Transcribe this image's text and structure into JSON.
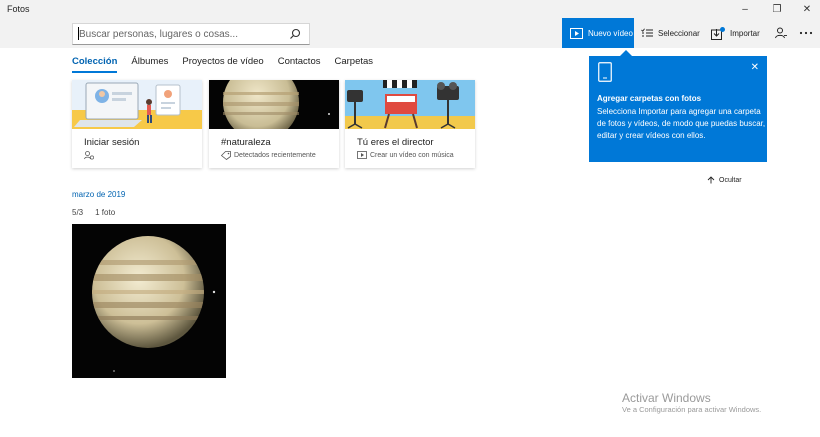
{
  "app": {
    "title": "Fotos"
  },
  "window_controls": [
    {
      "name": "minimize",
      "glyph": "–"
    },
    {
      "name": "restore",
      "glyph": "❐"
    },
    {
      "name": "close",
      "glyph": "✕"
    }
  ],
  "search": {
    "placeholder": "Buscar personas, lugares o cosas..."
  },
  "toolbar": {
    "new_video_label": "Nuevo vídeo",
    "select_label": "Seleccionar",
    "import_label": "Importar"
  },
  "tabs": [
    {
      "label": "Colección",
      "active": true
    },
    {
      "label": "Álbumes",
      "active": false
    },
    {
      "label": "Proyectos de vídeo",
      "active": false
    },
    {
      "label": "Contactos",
      "active": false
    },
    {
      "label": "Carpetas",
      "active": false
    }
  ],
  "cards": [
    {
      "title": "Iniciar sesión",
      "subtitle": "",
      "icon": "person-sync-icon"
    },
    {
      "title": "#naturaleza",
      "subtitle": "Detectados recientemente",
      "icon": "tag-icon"
    },
    {
      "title": "Tú eres el director",
      "subtitle": "Crear un vídeo con música",
      "icon": "video-icon"
    }
  ],
  "popup": {
    "heading": "Agregar carpetas con fotos",
    "body": "Selecciona Importar para agregar una carpeta de fotos y vídeos, de modo que puedas buscar, editar y crear vídeos con ellos.",
    "icon": "tablet-icon"
  },
  "hide_label": "Ocultar",
  "gallery": {
    "date_heading": "marzo de 2019",
    "day": "5/3",
    "count": "1 foto"
  },
  "watermark": {
    "title": "Activar Windows",
    "subtitle": "Ve a Configuración para activar Windows."
  },
  "colors": {
    "accent": "#0078d7",
    "accent_text": "#0063b1",
    "chrome": "#f2f2f2"
  }
}
